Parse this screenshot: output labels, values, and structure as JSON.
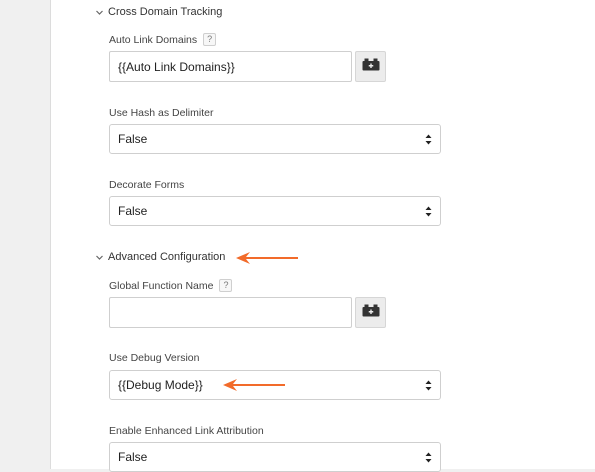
{
  "sections": {
    "cross_domain": {
      "title": "Cross Domain Tracking"
    },
    "advanced": {
      "title": "Advanced Configuration"
    }
  },
  "fields": {
    "auto_link_domains": {
      "label": "Auto Link Domains",
      "help": "?",
      "value": "{{Auto Link Domains}}"
    },
    "use_hash": {
      "label": "Use Hash as Delimiter",
      "value": "False"
    },
    "decorate_forms": {
      "label": "Decorate Forms",
      "value": "False"
    },
    "global_function_name": {
      "label": "Global Function Name",
      "help": "?",
      "value": ""
    },
    "use_debug_version": {
      "label": "Use Debug Version",
      "value": "{{Debug Mode}}"
    },
    "enhanced_link_attr": {
      "label": "Enable Enhanced Link Attribution",
      "value": "False"
    }
  },
  "icons": {
    "chevron": "chevron-down-icon",
    "variable_picker": "variable-picker-icon",
    "select_caret": "select-caret-icon",
    "annotation_arrow": "left-arrow-icon"
  },
  "colors": {
    "annotation_arrow": "#f26b2a",
    "panel_bg": "#ffffff",
    "gutter_bg": "#f0f0f0"
  }
}
